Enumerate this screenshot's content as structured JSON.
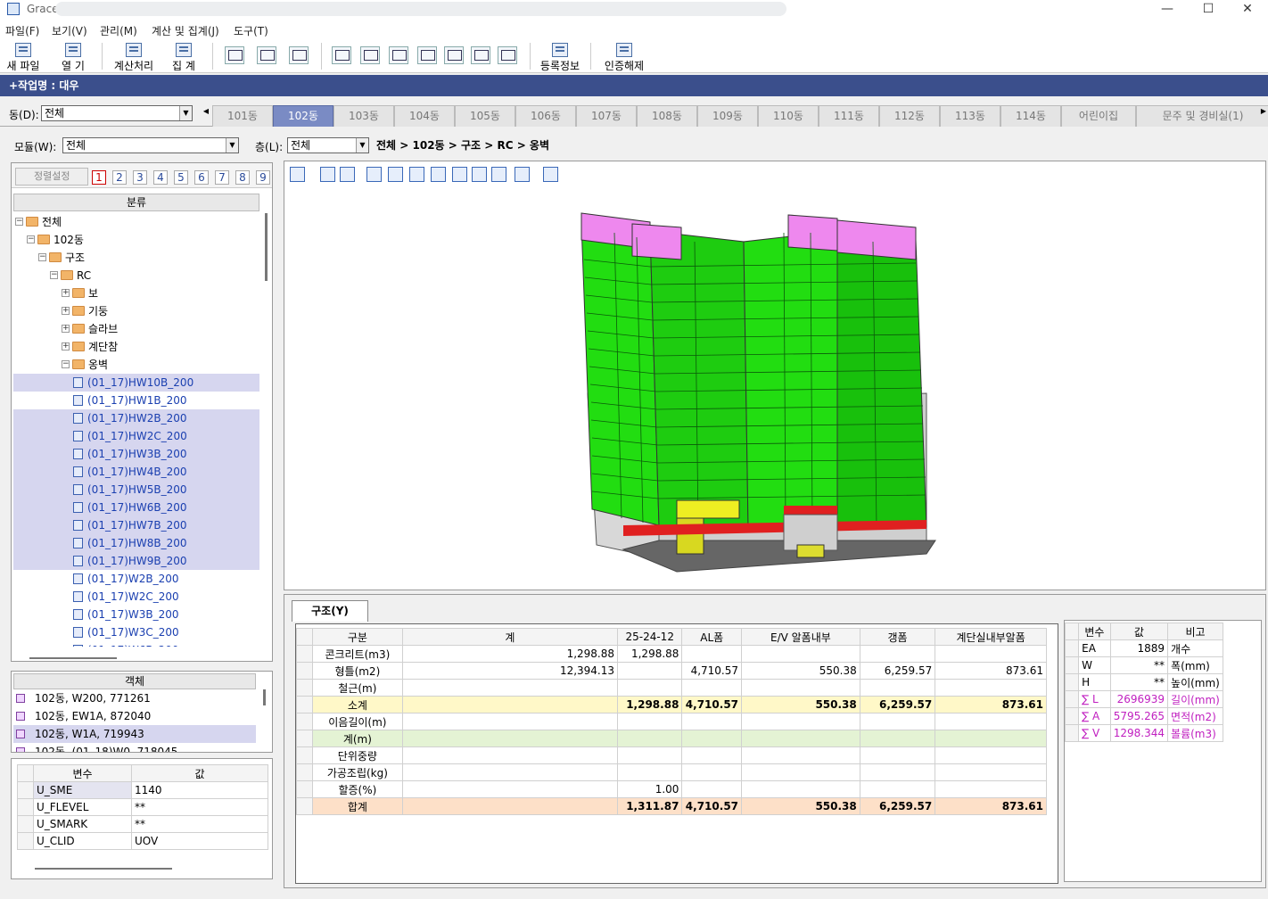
{
  "window": {
    "title": "Grace",
    "minimize": "—",
    "maximize": "☐",
    "close": "✕"
  },
  "menu": [
    "파일(F)",
    "보기(V)",
    "관리(M)",
    "계산 및 집계(J)",
    "도구(T)"
  ],
  "toolbar": {
    "new_file": "새 파일",
    "open": "열  기",
    "calculate": "계산처리",
    "aggregate": "집  계",
    "registration": "등록정보",
    "unlock": "인증해제"
  },
  "job": {
    "label": "+작업명 : 대우"
  },
  "dong": {
    "label": "동(D):",
    "value": "전체"
  },
  "tabs": [
    "101동",
    "102동",
    "103동",
    "104동",
    "105동",
    "106동",
    "107동",
    "108동",
    "109동",
    "110동",
    "111동",
    "112동",
    "113동",
    "114동",
    "어린이집",
    "경비실(1)"
  ],
  "tab_prefix_last": "문주 및 ",
  "active_tab": "102동",
  "filters": {
    "model_label": "모듈(W):",
    "model_value": "전체",
    "floor_label": "층(L):",
    "floor_value": "전체",
    "breadcrumb": "전체 > 102동 > 구조 > RC > 옹벽"
  },
  "left": {
    "sort_label": "정렬설정",
    "numbers": [
      "1",
      "2",
      "3",
      "4",
      "5",
      "6",
      "7",
      "8",
      "9"
    ],
    "tree_header": "분류",
    "tree": [
      {
        "label": "전체",
        "level": 0,
        "type": "folder",
        "exp": "−"
      },
      {
        "label": "102동",
        "level": 1,
        "type": "folder",
        "exp": "−"
      },
      {
        "label": "구조",
        "level": 2,
        "type": "folder",
        "exp": "−"
      },
      {
        "label": "RC",
        "level": 3,
        "type": "folder",
        "exp": "−"
      },
      {
        "label": "보",
        "level": 4,
        "type": "folder",
        "exp": "+"
      },
      {
        "label": "기둥",
        "level": 4,
        "type": "folder",
        "exp": "+"
      },
      {
        "label": "슬라브",
        "level": 4,
        "type": "folder",
        "exp": "+"
      },
      {
        "label": "계단참",
        "level": 4,
        "type": "folder",
        "exp": "+"
      },
      {
        "label": "옹벽",
        "level": 4,
        "type": "folder",
        "exp": "−"
      },
      {
        "label": "(01_17)HW10B_200",
        "level": 5,
        "type": "leaf",
        "sel": true
      },
      {
        "label": "(01_17)HW1B_200",
        "level": 5,
        "type": "leaf",
        "sel": false
      },
      {
        "label": "(01_17)HW2B_200",
        "level": 5,
        "type": "leaf",
        "sel": true
      },
      {
        "label": "(01_17)HW2C_200",
        "level": 5,
        "type": "leaf",
        "sel": true
      },
      {
        "label": "(01_17)HW3B_200",
        "level": 5,
        "type": "leaf",
        "sel": true
      },
      {
        "label": "(01_17)HW4B_200",
        "level": 5,
        "type": "leaf",
        "sel": true
      },
      {
        "label": "(01_17)HW5B_200",
        "level": 5,
        "type": "leaf",
        "sel": true
      },
      {
        "label": "(01_17)HW6B_200",
        "level": 5,
        "type": "leaf",
        "sel": true
      },
      {
        "label": "(01_17)HW7B_200",
        "level": 5,
        "type": "leaf",
        "sel": true
      },
      {
        "label": "(01_17)HW8B_200",
        "level": 5,
        "type": "leaf",
        "sel": true
      },
      {
        "label": "(01_17)HW9B_200",
        "level": 5,
        "type": "leaf",
        "sel": true
      },
      {
        "label": "(01_17)W2B_200",
        "level": 5,
        "type": "leaf",
        "sel": false
      },
      {
        "label": "(01_17)W2C_200",
        "level": 5,
        "type": "leaf",
        "sel": false
      },
      {
        "label": "(01_17)W3B_200",
        "level": 5,
        "type": "leaf",
        "sel": false
      },
      {
        "label": "(01_17)W3C_200",
        "level": 5,
        "type": "leaf",
        "sel": false
      },
      {
        "label": "(01_17)W6B_200",
        "level": 5,
        "type": "leaf",
        "sel": false
      }
    ],
    "objects_header": "객체",
    "objects": [
      {
        "label": "102동, W200, 771261",
        "sel": false
      },
      {
        "label": "102동, EW1A, 872040",
        "sel": false
      },
      {
        "label": "102동, W1A, 719943",
        "sel": true
      },
      {
        "label": "102동, (01_18)W0, 718045",
        "sel": false
      }
    ],
    "vars_header": {
      "name": "변수",
      "value": "값"
    },
    "vars": [
      {
        "name": "U_SME",
        "value": "1140"
      },
      {
        "name": "U_FLEVEL",
        "value": "**"
      },
      {
        "name": "U_SMARK",
        "value": "**"
      },
      {
        "name": "U_CLID",
        "value": "UOV"
      }
    ]
  },
  "main_tab": "구조(Y)",
  "grid": {
    "headers": [
      "구분",
      "계",
      "25-24-12",
      "AL폼",
      "E/V 알폼내부",
      "갱폼",
      "계단실내부알폼"
    ],
    "rows": [
      {
        "name": "콘크리트(m3)",
        "cells": [
          "1,298.88",
          "1,298.88",
          "",
          "",
          "",
          ""
        ],
        "style": ""
      },
      {
        "name": "형틀(m2)",
        "cells": [
          "12,394.13",
          "",
          "4,710.57",
          "550.38",
          "6,259.57",
          "873.61"
        ],
        "style": ""
      },
      {
        "name": "철근(m)",
        "cells": [
          "",
          "",
          "",
          "",
          "",
          ""
        ],
        "style": ""
      },
      {
        "name": "소계",
        "cells": [
          "",
          "1,298.88",
          "4,710.57",
          "550.38",
          "6,259.57",
          "873.61"
        ],
        "style": "subtotal"
      },
      {
        "name": "이음길이(m)",
        "cells": [
          "",
          "",
          "",
          "",
          "",
          ""
        ],
        "style": ""
      },
      {
        "name": "계(m)",
        "cells": [
          "",
          "",
          "",
          "",
          "",
          ""
        ],
        "style": "green"
      },
      {
        "name": "단위중량",
        "cells": [
          "",
          "",
          "",
          "",
          "",
          ""
        ],
        "style": ""
      },
      {
        "name": "가공조립(kg)",
        "cells": [
          "",
          "",
          "",
          "",
          "",
          ""
        ],
        "style": ""
      },
      {
        "name": "할증(%)",
        "cells": [
          "",
          "1.00",
          "",
          "",
          "",
          ""
        ],
        "style": ""
      },
      {
        "name": "합계",
        "cells": [
          "",
          "1,311.87",
          "4,710.57",
          "550.38",
          "6,259.57",
          "873.61"
        ],
        "style": "total"
      }
    ]
  },
  "side": {
    "headers": [
      "변수",
      "값",
      "비고"
    ],
    "rows": [
      {
        "name": "EA",
        "value": "1889",
        "note": "개수",
        "sigma": false
      },
      {
        "name": "W",
        "value": "**",
        "note": "폭(mm)",
        "sigma": false
      },
      {
        "name": "H",
        "value": "**",
        "note": "높이(mm)",
        "sigma": false
      },
      {
        "name": "∑ L",
        "value": "2696939",
        "note": "길이(mm)",
        "sigma": true
      },
      {
        "name": "∑ A",
        "value": "5795.265",
        "note": "면적(m2)",
        "sigma": true
      },
      {
        "name": "∑ V",
        "value": "1298.344",
        "note": "볼륨(m3)",
        "sigma": true
      }
    ]
  },
  "colors": {
    "accent": "#3b4f8c",
    "active_tab": "#7a8bc4",
    "model_green": "#22dd11",
    "model_pink": "#ee88ee",
    "sigma_text": "#c020c0"
  }
}
